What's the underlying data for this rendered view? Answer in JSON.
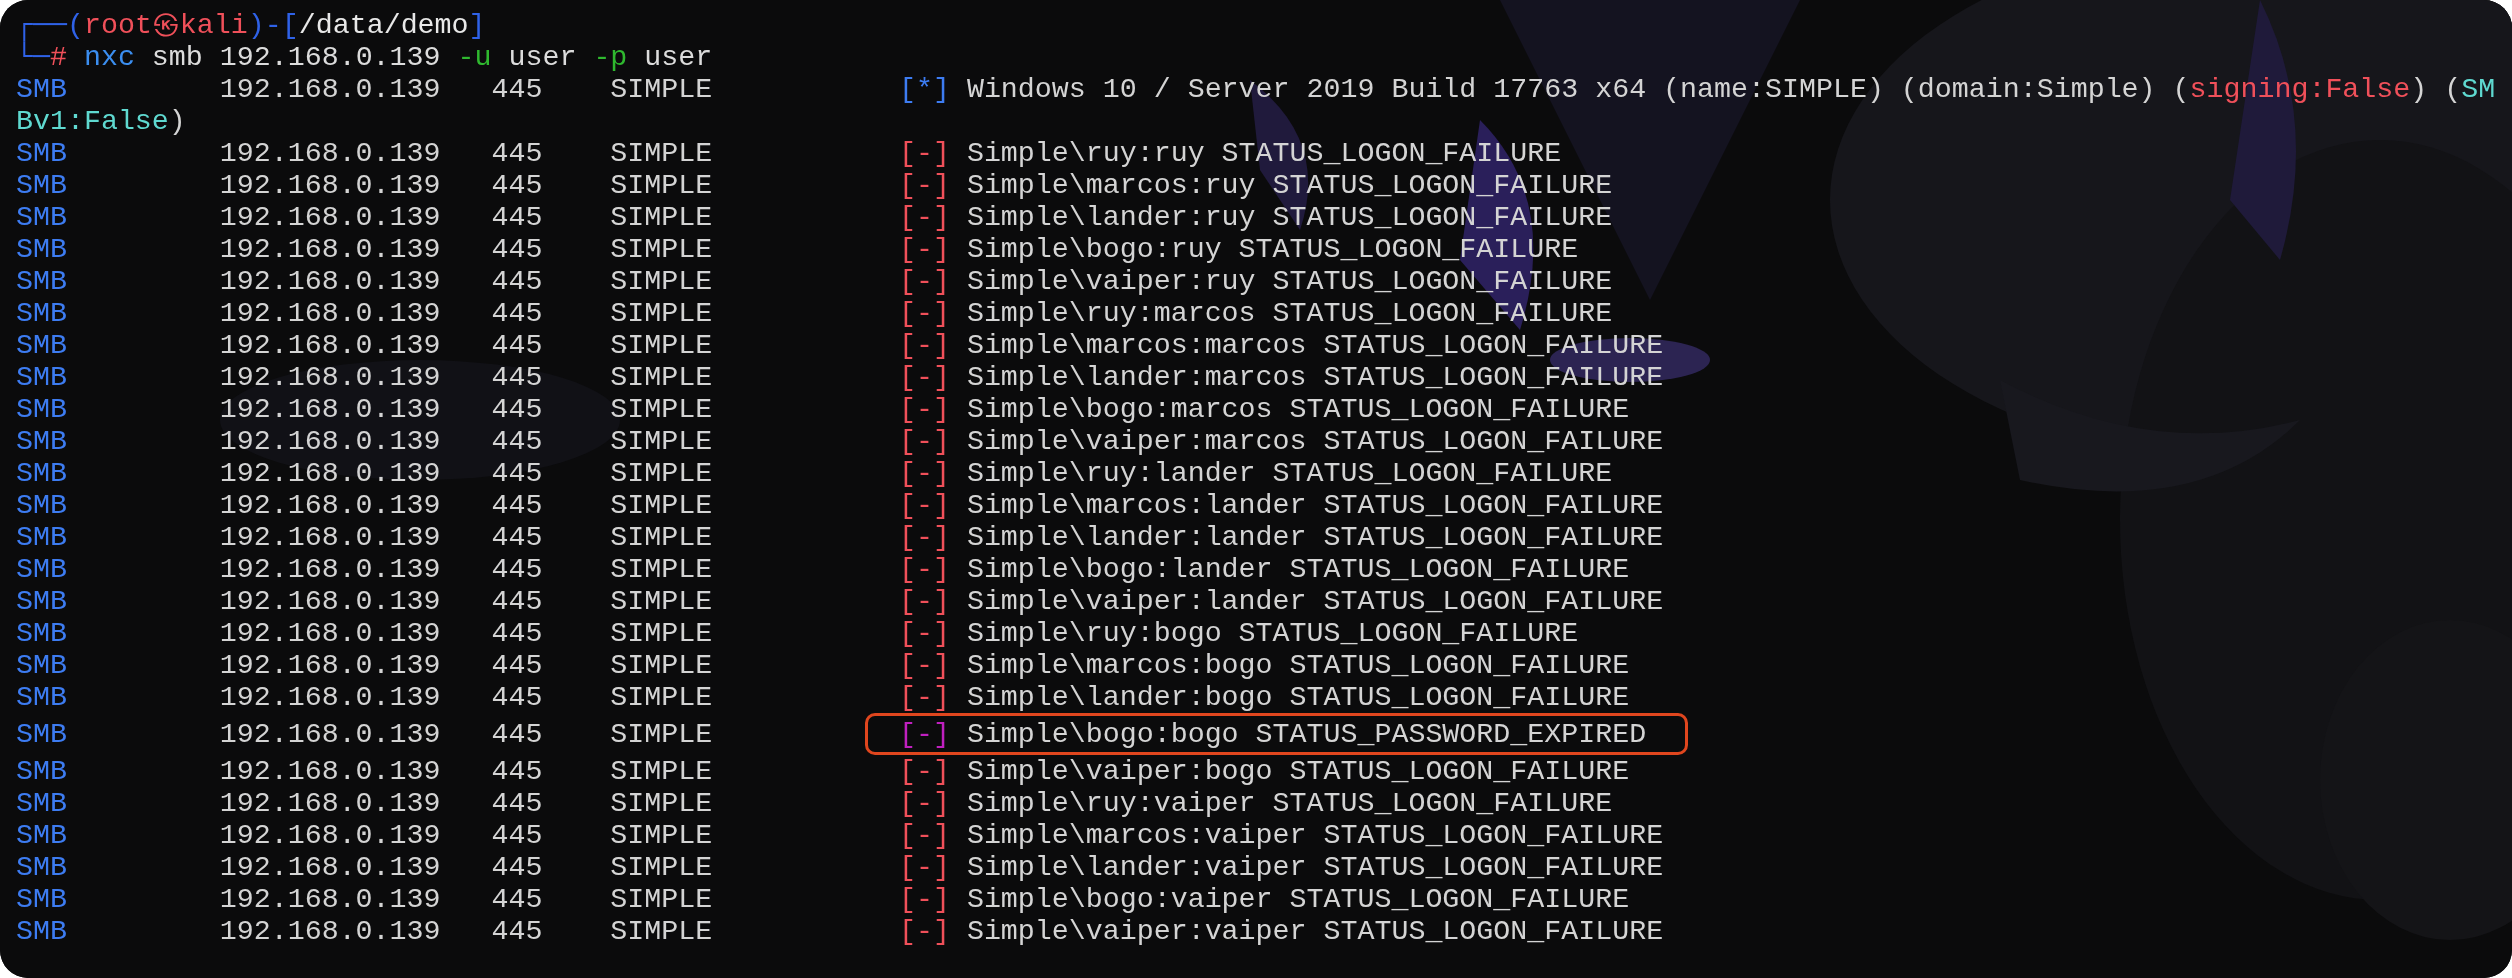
{
  "prompt": [
    {
      "kind": "frame",
      "text": "┌──("
    },
    {
      "kind": "user",
      "text": "root㉿kali"
    },
    {
      "kind": "frame",
      "text": ")-["
    },
    {
      "kind": "path",
      "text": "/data/demo"
    },
    {
      "kind": "frame",
      "text": "]"
    }
  ],
  "command_line": [
    {
      "kind": "frame",
      "text": "└─"
    },
    {
      "kind": "user",
      "text": "#"
    },
    {
      "kind": "program",
      "text": " nxc"
    },
    {
      "kind": "arg",
      "text": " smb 192.168.0.139 "
    },
    {
      "kind": "flag",
      "text": "-u"
    },
    {
      "kind": "arg",
      "text": " user "
    },
    {
      "kind": "flag",
      "text": "-p"
    },
    {
      "kind": "arg",
      "text": " user"
    }
  ],
  "rows": [
    {
      "protocol": "SMB",
      "ip": "192.168.0.139",
      "port": "445",
      "host": "SIMPLE",
      "marker": "[*]",
      "color": "#3d7cf2",
      "highlighted": false,
      "message": [
        {
          "kind": "plain",
          "text": "Windows 10 / Server 2019 Build 17763 x64 (name:SIMPLE) (domain:Simple) ("
        },
        {
          "kind": "alert",
          "text": "signing:False"
        },
        {
          "kind": "plain",
          "text": ") ("
        },
        {
          "kind": "note",
          "text": "SM"
        }
      ],
      "wrapped": [
        {
          "kind": "note",
          "text": "Bv1:False"
        },
        {
          "kind": "plain",
          "text": ")"
        }
      ]
    },
    {
      "protocol": "SMB",
      "ip": "192.168.0.139",
      "port": "445",
      "host": "SIMPLE",
      "marker": "[-]",
      "color": "#f0505a",
      "highlighted": false,
      "message": [
        {
          "kind": "plain",
          "text": "Simple\\ruy:ruy STATUS_LOGON_FAILURE"
        }
      ]
    },
    {
      "protocol": "SMB",
      "ip": "192.168.0.139",
      "port": "445",
      "host": "SIMPLE",
      "marker": "[-]",
      "color": "#f0505a",
      "highlighted": false,
      "message": [
        {
          "kind": "plain",
          "text": "Simple\\marcos:ruy STATUS_LOGON_FAILURE"
        }
      ]
    },
    {
      "protocol": "SMB",
      "ip": "192.168.0.139",
      "port": "445",
      "host": "SIMPLE",
      "marker": "[-]",
      "color": "#f0505a",
      "highlighted": false,
      "message": [
        {
          "kind": "plain",
          "text": "Simple\\lander:ruy STATUS_LOGON_FAILURE"
        }
      ]
    },
    {
      "protocol": "SMB",
      "ip": "192.168.0.139",
      "port": "445",
      "host": "SIMPLE",
      "marker": "[-]",
      "color": "#f0505a",
      "highlighted": false,
      "message": [
        {
          "kind": "plain",
          "text": "Simple\\bogo:ruy STATUS_LOGON_FAILURE"
        }
      ]
    },
    {
      "protocol": "SMB",
      "ip": "192.168.0.139",
      "port": "445",
      "host": "SIMPLE",
      "marker": "[-]",
      "color": "#f0505a",
      "highlighted": false,
      "message": [
        {
          "kind": "plain",
          "text": "Simple\\vaiper:ruy STATUS_LOGON_FAILURE"
        }
      ]
    },
    {
      "protocol": "SMB",
      "ip": "192.168.0.139",
      "port": "445",
      "host": "SIMPLE",
      "marker": "[-]",
      "color": "#f0505a",
      "highlighted": false,
      "message": [
        {
          "kind": "plain",
          "text": "Simple\\ruy:marcos STATUS_LOGON_FAILURE"
        }
      ]
    },
    {
      "protocol": "SMB",
      "ip": "192.168.0.139",
      "port": "445",
      "host": "SIMPLE",
      "marker": "[-]",
      "color": "#f0505a",
      "highlighted": false,
      "message": [
        {
          "kind": "plain",
          "text": "Simple\\marcos:marcos STATUS_LOGON_FAILURE"
        }
      ]
    },
    {
      "protocol": "SMB",
      "ip": "192.168.0.139",
      "port": "445",
      "host": "SIMPLE",
      "marker": "[-]",
      "color": "#f0505a",
      "highlighted": false,
      "message": [
        {
          "kind": "plain",
          "text": "Simple\\lander:marcos STATUS_LOGON_FAILURE"
        }
      ]
    },
    {
      "protocol": "SMB",
      "ip": "192.168.0.139",
      "port": "445",
      "host": "SIMPLE",
      "marker": "[-]",
      "color": "#f0505a",
      "highlighted": false,
      "message": [
        {
          "kind": "plain",
          "text": "Simple\\bogo:marcos STATUS_LOGON_FAILURE"
        }
      ]
    },
    {
      "protocol": "SMB",
      "ip": "192.168.0.139",
      "port": "445",
      "host": "SIMPLE",
      "marker": "[-]",
      "color": "#f0505a",
      "highlighted": false,
      "message": [
        {
          "kind": "plain",
          "text": "Simple\\vaiper:marcos STATUS_LOGON_FAILURE"
        }
      ]
    },
    {
      "protocol": "SMB",
      "ip": "192.168.0.139",
      "port": "445",
      "host": "SIMPLE",
      "marker": "[-]",
      "color": "#f0505a",
      "highlighted": false,
      "message": [
        {
          "kind": "plain",
          "text": "Simple\\ruy:lander STATUS_LOGON_FAILURE"
        }
      ]
    },
    {
      "protocol": "SMB",
      "ip": "192.168.0.139",
      "port": "445",
      "host": "SIMPLE",
      "marker": "[-]",
      "color": "#f0505a",
      "highlighted": false,
      "message": [
        {
          "kind": "plain",
          "text": "Simple\\marcos:lander STATUS_LOGON_FAILURE"
        }
      ]
    },
    {
      "protocol": "SMB",
      "ip": "192.168.0.139",
      "port": "445",
      "host": "SIMPLE",
      "marker": "[-]",
      "color": "#f0505a",
      "highlighted": false,
      "message": [
        {
          "kind": "plain",
          "text": "Simple\\lander:lander STATUS_LOGON_FAILURE"
        }
      ]
    },
    {
      "protocol": "SMB",
      "ip": "192.168.0.139",
      "port": "445",
      "host": "SIMPLE",
      "marker": "[-]",
      "color": "#f0505a",
      "highlighted": false,
      "message": [
        {
          "kind": "plain",
          "text": "Simple\\bogo:lander STATUS_LOGON_FAILURE"
        }
      ]
    },
    {
      "protocol": "SMB",
      "ip": "192.168.0.139",
      "port": "445",
      "host": "SIMPLE",
      "marker": "[-]",
      "color": "#f0505a",
      "highlighted": false,
      "message": [
        {
          "kind": "plain",
          "text": "Simple\\vaiper:lander STATUS_LOGON_FAILURE"
        }
      ]
    },
    {
      "protocol": "SMB",
      "ip": "192.168.0.139",
      "port": "445",
      "host": "SIMPLE",
      "marker": "[-]",
      "color": "#f0505a",
      "highlighted": false,
      "message": [
        {
          "kind": "plain",
          "text": "Simple\\ruy:bogo STATUS_LOGON_FAILURE"
        }
      ]
    },
    {
      "protocol": "SMB",
      "ip": "192.168.0.139",
      "port": "445",
      "host": "SIMPLE",
      "marker": "[-]",
      "color": "#f0505a",
      "highlighted": false,
      "message": [
        {
          "kind": "plain",
          "text": "Simple\\marcos:bogo STATUS_LOGON_FAILURE"
        }
      ]
    },
    {
      "protocol": "SMB",
      "ip": "192.168.0.139",
      "port": "445",
      "host": "SIMPLE",
      "marker": "[-]",
      "color": "#f0505a",
      "highlighted": false,
      "message": [
        {
          "kind": "plain",
          "text": "Simple\\lander:bogo STATUS_LOGON_FAILURE"
        }
      ]
    },
    {
      "protocol": "SMB",
      "ip": "192.168.0.139",
      "port": "445",
      "host": "SIMPLE",
      "marker": "[-]",
      "color": "#c020c0",
      "highlighted": true,
      "message": [
        {
          "kind": "plain",
          "text": "Simple\\bogo:bogo STATUS_PASSWORD_EXPIRED"
        }
      ]
    },
    {
      "protocol": "SMB",
      "ip": "192.168.0.139",
      "port": "445",
      "host": "SIMPLE",
      "marker": "[-]",
      "color": "#f0505a",
      "highlighted": false,
      "message": [
        {
          "kind": "plain",
          "text": "Simple\\vaiper:bogo STATUS_LOGON_FAILURE"
        }
      ]
    },
    {
      "protocol": "SMB",
      "ip": "192.168.0.139",
      "port": "445",
      "host": "SIMPLE",
      "marker": "[-]",
      "color": "#f0505a",
      "highlighted": false,
      "message": [
        {
          "kind": "plain",
          "text": "Simple\\ruy:vaiper STATUS_LOGON_FAILURE"
        }
      ]
    },
    {
      "protocol": "SMB",
      "ip": "192.168.0.139",
      "port": "445",
      "host": "SIMPLE",
      "marker": "[-]",
      "color": "#f0505a",
      "highlighted": false,
      "message": [
        {
          "kind": "plain",
          "text": "Simple\\marcos:vaiper STATUS_LOGON_FAILURE"
        }
      ]
    },
    {
      "protocol": "SMB",
      "ip": "192.168.0.139",
      "port": "445",
      "host": "SIMPLE",
      "marker": "[-]",
      "color": "#f0505a",
      "highlighted": false,
      "message": [
        {
          "kind": "plain",
          "text": "Simple\\lander:vaiper STATUS_LOGON_FAILURE"
        }
      ]
    },
    {
      "protocol": "SMB",
      "ip": "192.168.0.139",
      "port": "445",
      "host": "SIMPLE",
      "marker": "[-]",
      "color": "#f0505a",
      "highlighted": false,
      "message": [
        {
          "kind": "plain",
          "text": "Simple\\bogo:vaiper STATUS_LOGON_FAILURE"
        }
      ]
    },
    {
      "protocol": "SMB",
      "ip": "192.168.0.139",
      "port": "445",
      "host": "SIMPLE",
      "marker": "[-]",
      "color": "#f0505a",
      "highlighted": false,
      "message": [
        {
          "kind": "plain",
          "text": "Simple\\vaiper:vaiper STATUS_LOGON_FAILURE"
        }
      ]
    }
  ]
}
